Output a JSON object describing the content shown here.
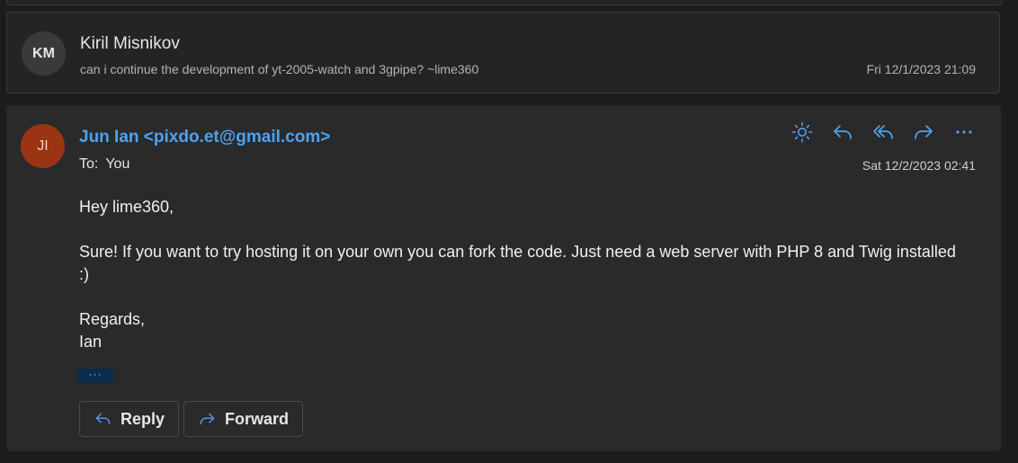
{
  "thread": [
    {
      "initials": "KM",
      "sender": "Kiril Misnikov",
      "preview": "can i continue the development of yt-2005-watch and 3gpipe? ~lime360",
      "date": "Fri 12/1/2023 21:09"
    },
    {
      "initials": "JI",
      "sender": "Jun Ian <pixdo.et@gmail.com>",
      "to_label": "To:",
      "to_value": "You",
      "date": "Sat 12/2/2023 02:41",
      "body": {
        "greeting": "Hey lime360,",
        "paragraph": "Sure! If you want to try hosting it on your own you can fork the code. Just need a web server with PHP 8 and Twig installed :)",
        "closing": "Regards,",
        "signature": "Ian"
      },
      "more_dots": "···",
      "actions": [
        {
          "name": "sun-icon",
          "label": "Theme"
        },
        {
          "name": "reply-icon",
          "label": "Reply"
        },
        {
          "name": "reply-all-icon",
          "label": "Reply all"
        },
        {
          "name": "forward-icon",
          "label": "Forward"
        },
        {
          "name": "more-icon",
          "label": "More actions"
        }
      ],
      "buttons": {
        "reply_label": "Reply",
        "forward_label": "Forward"
      }
    }
  ],
  "colors": {
    "background": "#1c1c1c",
    "card": "#2a2a2a",
    "accent": "#4ea1f3",
    "avatar_ji": "#9a3412",
    "avatar_km": "#3a3a3a"
  }
}
